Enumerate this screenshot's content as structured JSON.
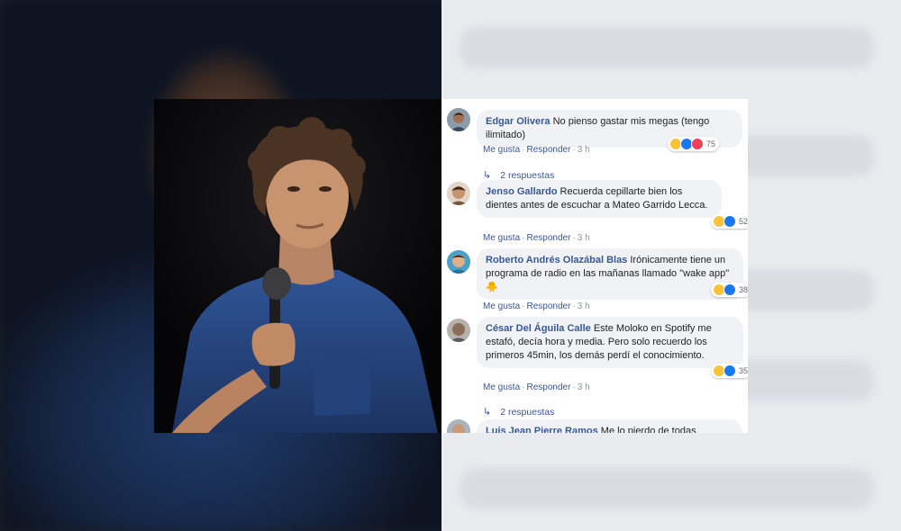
{
  "actions": {
    "like": "Me gusta",
    "reply": "Responder"
  },
  "comments": [
    {
      "author": "Edgar Olivera",
      "text": "No pienso gastar mis megas (tengo ilimitado)",
      "time": "3 h",
      "reaction_count": "75",
      "reactions": [
        "haha-icon",
        "like-icon",
        "love-icon"
      ],
      "replies": "2 respuestas"
    },
    {
      "author": "Jenso Gallardo",
      "text": "Recuerda cepillarte bien los dientes antes de escuchar a Mateo Garrido Lecca.",
      "time": "3 h",
      "reaction_count": "52",
      "reactions": [
        "haha-icon",
        "like-icon"
      ]
    },
    {
      "author": "Roberto Andrés Olazábal Blas",
      "text": "Irónicamente tiene un programa de radio en las mañanas llamado \"wake app\" 🐥",
      "time": "3 h",
      "reaction_count": "38",
      "reactions": [
        "haha-icon",
        "like-icon"
      ]
    },
    {
      "author": "César Del Águila Calle",
      "text": "Este Moloko en Spotify me estafó, decía hora y media. Pero solo recuerdo los primeros 45min, los demás perdí el conocimiento.",
      "time": "3 h",
      "reaction_count": "35",
      "reactions": [
        "haha-icon",
        "like-icon"
      ],
      "replies": "2 respuestas"
    },
    {
      "author": "Luis Jean Pierre Ramos",
      "text": "Me lo pierdo de todas maneras"
    }
  ],
  "colors": {
    "link": "#385898",
    "bubble": "#f0f2f5",
    "haha": "#f7c33b",
    "like": "#1877f2",
    "love": "#f33e58"
  }
}
